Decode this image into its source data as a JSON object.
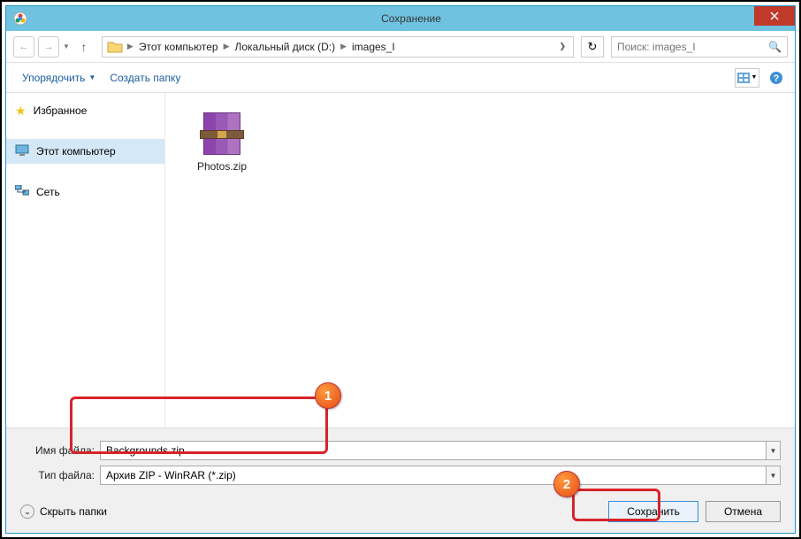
{
  "titlebar": {
    "title": "Сохранение"
  },
  "nav": {
    "crumbs": [
      "Этот компьютер",
      "Локальный диск (D:)",
      "images_I"
    ],
    "search_placeholder": "Поиск: images_I"
  },
  "toolbar": {
    "organize": "Упорядочить",
    "newfolder": "Создать папку"
  },
  "sidebar": {
    "favorites": "Избранное",
    "thispc": "Этот компьютер",
    "network": "Сеть"
  },
  "files": [
    {
      "name": "Photos.zip"
    }
  ],
  "form": {
    "filename_label": "Имя файла:",
    "filename_value": "Backgrounds.zip",
    "filetype_label": "Тип файла:",
    "filetype_value": "Архив ZIP - WinRAR (*.zip)"
  },
  "actions": {
    "hidefolders": "Скрыть папки",
    "save": "Сохранить",
    "cancel": "Отмена"
  },
  "callouts": {
    "one": "1",
    "two": "2"
  }
}
